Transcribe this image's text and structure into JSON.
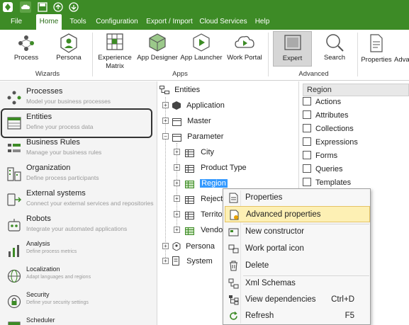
{
  "menu": {
    "tabs": [
      "File",
      "Home",
      "Tools",
      "Configuration",
      "Export / Import",
      "Cloud Services",
      "Help"
    ],
    "active_tab": "Home"
  },
  "ribbon": {
    "buttons": {
      "process": "Process",
      "persona": "Persona",
      "experience_matrix_line1": "Experience",
      "experience_matrix_line2": "Matrix",
      "app_designer": "App Designer",
      "app_launcher": "App Launcher",
      "work_portal": "Work Portal",
      "expert": "Expert",
      "search": "Search",
      "properties": "Properties",
      "advanced_partial": "Adva"
    },
    "groups": {
      "wizards": "Wizards",
      "apps": "Apps",
      "advanced": "Advanced"
    }
  },
  "leftnav": {
    "items": [
      {
        "title": "Processes",
        "subtitle": "Model your business processes"
      },
      {
        "title": "Entities",
        "subtitle": "Define your process data"
      },
      {
        "title": "Business Rules",
        "subtitle": "Manage your business rules"
      },
      {
        "title": "Organization",
        "subtitle": "Define process participants"
      },
      {
        "title": "External systems",
        "subtitle": "Connect your external services and repositories"
      },
      {
        "title": "Robots",
        "subtitle": "Integrate your automated applications"
      },
      {
        "title": "Analysis",
        "subtitle": "Define process metrics"
      },
      {
        "title": "Localization",
        "subtitle": "Adapt languages and regions"
      },
      {
        "title": "Security",
        "subtitle": "Define your security settings"
      },
      {
        "title": "Scheduler",
        "subtitle": ""
      }
    ]
  },
  "tree": {
    "root": "Entities",
    "application": "Application",
    "master": "Master",
    "parameter": "Parameter",
    "city": "City",
    "product_type": "Product Type",
    "region": "Region",
    "reject": "Reject",
    "territory": "Territo",
    "vendor": "Vendo",
    "persona": "Persona",
    "system": "System"
  },
  "rightpanel": {
    "header": "Region",
    "items": [
      "Actions",
      "Attributes",
      "Collections",
      "Expressions",
      "Forms",
      "Queries",
      "Templates"
    ]
  },
  "context_menu": {
    "items": [
      {
        "label": "Properties",
        "shortcut": ""
      },
      {
        "label": "Advanced properties",
        "shortcut": ""
      },
      {
        "label": "New constructor",
        "shortcut": ""
      },
      {
        "label": "Work portal icon",
        "shortcut": ""
      },
      {
        "label": "Delete",
        "shortcut": ""
      },
      {
        "label": "Xml Schemas",
        "shortcut": ""
      },
      {
        "label": "View dependencies",
        "shortcut": "Ctrl+D"
      },
      {
        "label": "Refresh",
        "shortcut": "F5"
      }
    ],
    "hovered": "Advanced properties"
  },
  "colors": {
    "brand_green": "#3d8b26",
    "selection_blue": "#3399ff",
    "hover_yellow": "#fdf0b4"
  }
}
